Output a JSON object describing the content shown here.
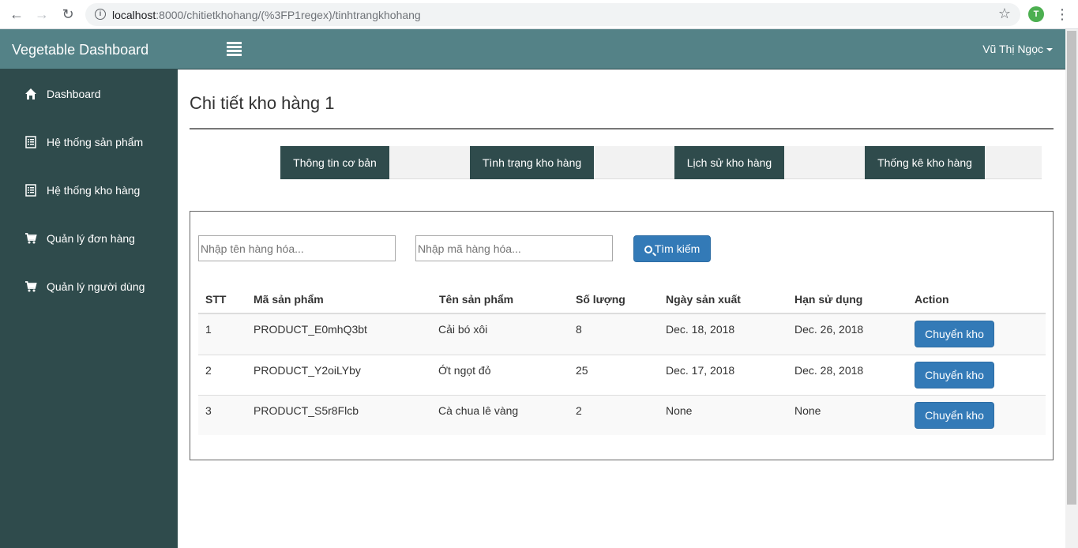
{
  "browser": {
    "url_host": "localhost",
    "url_path": ":8000/chitietkhohang/(%3FP1regex)/tinhtrangkhohang",
    "profile_initial": "T"
  },
  "topbar": {
    "brand": "Vegetable Dashboard",
    "user": "Vũ Thị Ngọc"
  },
  "sidebar": {
    "items": [
      {
        "label": "Dashboard",
        "icon": "home-icon"
      },
      {
        "label": "Hệ thống sản phẩm",
        "icon": "list-icon"
      },
      {
        "label": "Hệ thống kho hàng",
        "icon": "list-icon"
      },
      {
        "label": "Quản lý đơn hàng",
        "icon": "cart-icon"
      },
      {
        "label": "Quản lý người dùng",
        "icon": "cart-icon"
      }
    ]
  },
  "main": {
    "title": "Chi tiết kho hàng 1",
    "tabs": [
      {
        "label": "Thông tin cơ bản"
      },
      {
        "label": "Tình trạng kho hàng"
      },
      {
        "label": "Lịch sử kho hàng"
      },
      {
        "label": "Thống kê kho hàng"
      }
    ],
    "search": {
      "name_placeholder": "Nhập tên hàng hóa...",
      "code_placeholder": "Nhập mã hàng hóa...",
      "button_label": "Tìm kiếm"
    },
    "table": {
      "headers": [
        "STT",
        "Mã sản phẩm",
        "Tên sản phẩm",
        "Số lượng",
        "Ngày sản xuất",
        "Hạn sử dụng",
        "Action"
      ],
      "rows": [
        {
          "stt": "1",
          "code": "PRODUCT_E0mhQ3bt",
          "name": "Cải bó xôi",
          "qty": "8",
          "mfg": "Dec. 18, 2018",
          "exp": "Dec. 26, 2018",
          "action": "Chuyển kho"
        },
        {
          "stt": "2",
          "code": "PRODUCT_Y2oiLYby",
          "name": "Ớt ngọt đỏ",
          "qty": "25",
          "mfg": "Dec. 17, 2018",
          "exp": "Dec. 28, 2018",
          "action": "Chuyển kho"
        },
        {
          "stt": "3",
          "code": "PRODUCT_S5r8Flcb",
          "name": "Cà chua lê vàng",
          "qty": "2",
          "mfg": "None",
          "exp": "None",
          "action": "Chuyển kho"
        }
      ]
    }
  },
  "colors": {
    "topbar": "#548287",
    "sidebar": "#2f4b4c",
    "primary_button": "#337ab7"
  }
}
